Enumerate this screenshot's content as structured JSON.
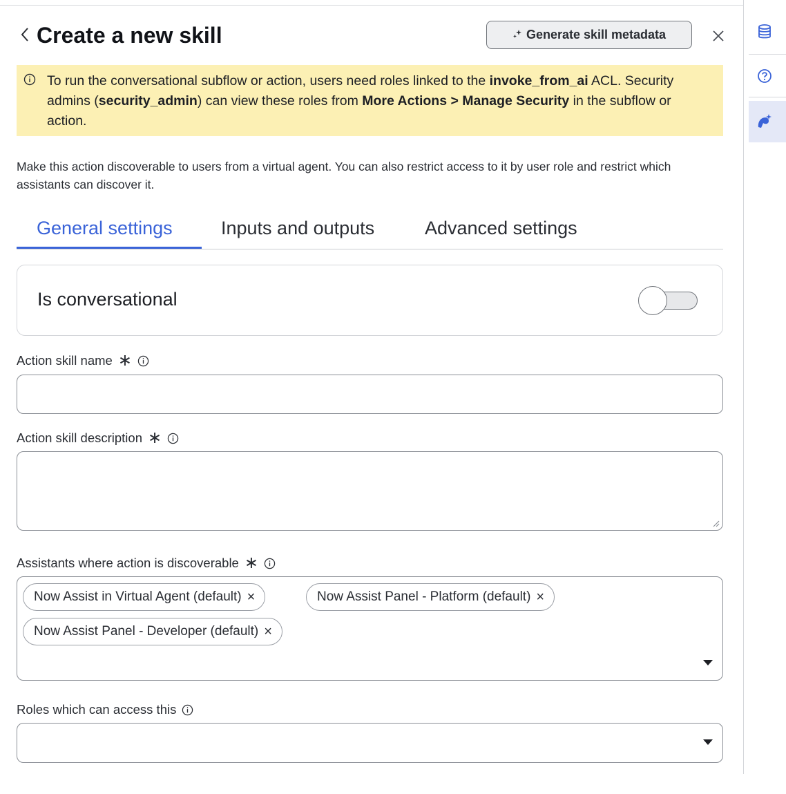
{
  "header": {
    "title": "Create a new skill",
    "generate_button": "Generate skill metadata",
    "icons": {
      "back": "chevron-left-icon",
      "close": "close-icon",
      "sparkle": "sparkle-icon"
    }
  },
  "banner": {
    "icon": "info-icon",
    "text1": "To run the conversational subflow or action, users need roles linked to the ",
    "bold1": "invoke_from_ai",
    "text2": " ACL. Security admins (",
    "bold2": "security_admin",
    "text3": ") can view these roles from ",
    "bold3": "More Actions > Manage Security",
    "text4": " in the subflow or action."
  },
  "intro": "Make this action discoverable to users from a virtual agent. You can also restrict access to it by user role and restrict which assistants can discover it.",
  "tabs": [
    {
      "label": "General settings",
      "active": true
    },
    {
      "label": "Inputs and outputs",
      "active": false
    },
    {
      "label": "Advanced settings",
      "active": false
    }
  ],
  "conversational": {
    "label": "Is conversational",
    "enabled": false
  },
  "fields": {
    "skill_name": {
      "label": "Action skill name",
      "required_mark": "∗",
      "value": ""
    },
    "skill_description": {
      "label": "Action skill description",
      "required_mark": "∗",
      "value": ""
    },
    "assistants": {
      "label": "Assistants where action is discoverable",
      "required_mark": "∗",
      "chips": [
        "Now Assist in Virtual Agent (default)",
        "Now Assist Panel - Platform (default)",
        "Now Assist Panel - Developer (default)"
      ],
      "remove_glyph": "×"
    },
    "roles": {
      "label": "Roles which can access this",
      "value": ""
    }
  },
  "rail": {
    "icons": [
      "database-icon",
      "help-icon",
      "ai-skill-icon"
    ],
    "active": "ai-skill-icon"
  },
  "colors": {
    "accent": "#3a63d8",
    "banner_bg": "#fcf0b4",
    "rail_active_bg": "#e4e8f7"
  }
}
